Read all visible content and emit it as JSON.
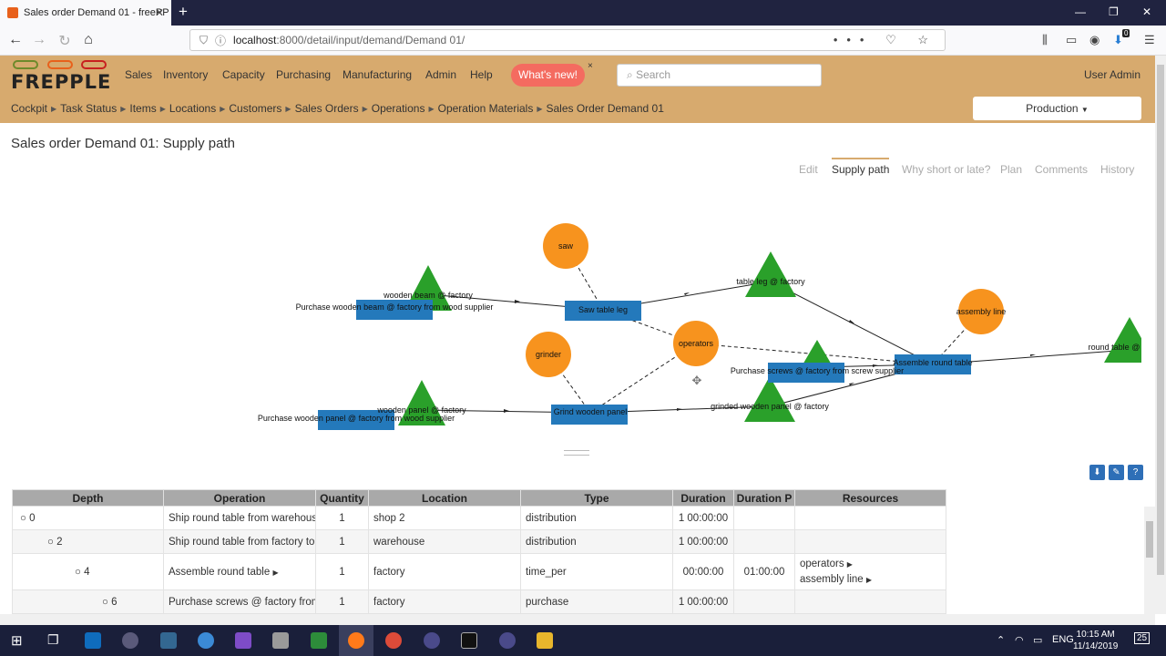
{
  "browser": {
    "tab_title": "Sales order Demand 01 - freePP",
    "url_host": "localhost",
    "url_path": ":8000/detail/input/demand/Demand 01/",
    "download_badge": "0"
  },
  "app": {
    "logo_text": "FREPPLE",
    "menu": [
      "Sales",
      "Inventory",
      "Capacity",
      "Purchasing",
      "Manufacturing",
      "Admin",
      "Help"
    ],
    "whats_new": "What's new!",
    "whats_new_close": "×",
    "search_placeholder": "Search",
    "user": "User Admin",
    "breadcrumbs": [
      "Cockpit",
      "Task Status",
      "Items",
      "Locations",
      "Customers",
      "Sales Orders",
      "Operations",
      "Operation Materials",
      "Sales Order Demand 01"
    ],
    "scenario": "Production"
  },
  "page": {
    "title": "Sales order Demand 01: Supply path",
    "tabs": [
      "Edit",
      "Supply path",
      "Why short or late?",
      "Plan",
      "Comments",
      "History"
    ],
    "active_tab": "Supply path"
  },
  "graph": {
    "resources": [
      "saw",
      "grinder",
      "operators",
      "assembly line"
    ],
    "buffers": [
      "wooden beam @ factory",
      "table leg @ factory",
      "screws @ factory",
      "wooden panel @ factory",
      "grinded wooden panel @ factory",
      "round table @"
    ],
    "operations": [
      "Purchase wooden beam @ factory from wood supplier",
      "Saw table leg",
      "Purchase screws @ factory from screw supplier",
      "Assemble round table",
      "Purchase wooden panel @ factory from wood supplier",
      "Grind wooden panel"
    ],
    "colors": {
      "resource": "#f7931e",
      "buffer": "#2aa02a",
      "operation": "#2479bb"
    }
  },
  "table": {
    "columns": [
      "Depth",
      "Operation",
      "Quantity",
      "Location",
      "Type",
      "Duration",
      "Duration P",
      "Resources"
    ],
    "rows": [
      {
        "depth": "0",
        "operation": "Ship round table from warehouse",
        "quantity": "1",
        "location": "shop 2",
        "type": "distribution",
        "duration": "1 00:00:00",
        "duration_p": "",
        "resources": []
      },
      {
        "depth": "2",
        "operation": "Ship round table from factory to",
        "quantity": "1",
        "location": "warehouse",
        "type": "distribution",
        "duration": "1 00:00:00",
        "duration_p": "",
        "resources": []
      },
      {
        "depth": "4",
        "operation": "Assemble round table",
        "quantity": "1",
        "location": "factory",
        "type": "time_per",
        "duration": "00:00:00",
        "duration_p": "01:00:00",
        "resources": [
          "operators",
          "assembly line"
        ]
      },
      {
        "depth": "6",
        "operation": "Purchase screws @ factory from",
        "quantity": "1",
        "location": "factory",
        "type": "purchase",
        "duration": "1 00:00:00",
        "duration_p": "",
        "resources": []
      }
    ]
  },
  "taskbar": {
    "lang": "ENG",
    "time": "10:15 AM",
    "date": "11/14/2019",
    "notifications": "25"
  }
}
